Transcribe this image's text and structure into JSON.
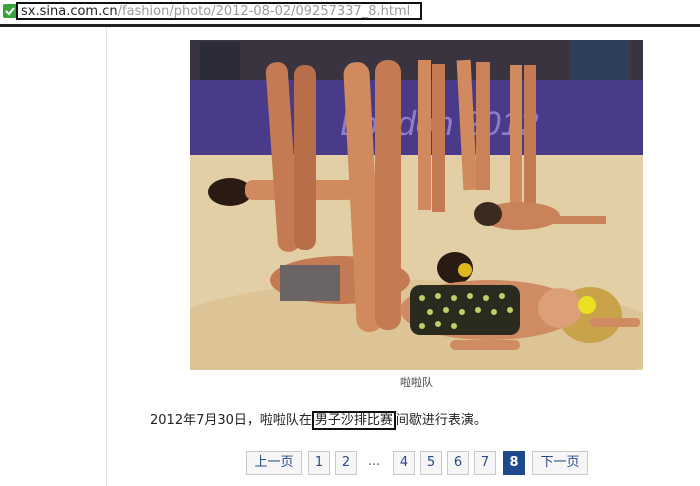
{
  "browser": {
    "url_domain": "sx.sina.com.cn",
    "url_path": "/fashion/photo/2012-08-02/09257337_8.html"
  },
  "photo": {
    "banner_text": "London 2012",
    "caption": "啦啦队"
  },
  "article": {
    "desc_before": "2012年7月30日，啦啦队在",
    "desc_highlight": "男子沙排比赛",
    "desc_after": "间歇进行表演。"
  },
  "pager": {
    "prev": "上一页",
    "pages": [
      "1",
      "2",
      "...",
      "4",
      "5",
      "6",
      "7",
      "8"
    ],
    "current": "8",
    "next": "下一页"
  },
  "colors": {
    "banner": "#4a3a8a",
    "sand": "#e3cfa6",
    "pager_active": "#1e4a8c"
  }
}
